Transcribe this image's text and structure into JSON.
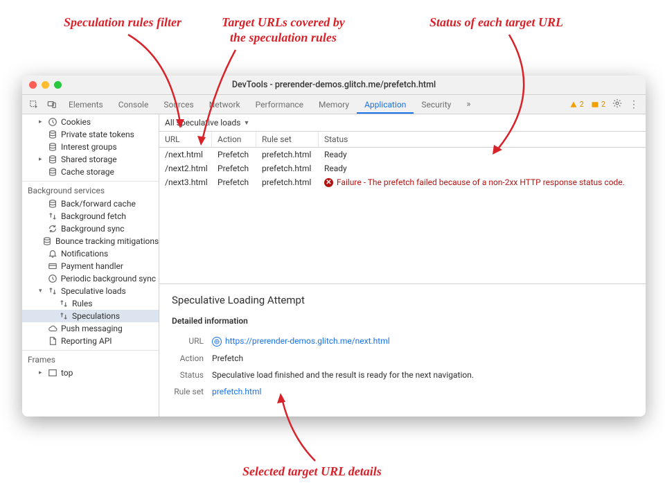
{
  "annotations": {
    "filter": "Speculation rules filter",
    "targets": "Target URLs covered by\nthe speculation rules",
    "status": "Status of each target URL",
    "details": "Selected target URL details"
  },
  "window": {
    "title": "DevTools - prerender-demos.glitch.me/prefetch.html"
  },
  "tabs": {
    "items": [
      "Elements",
      "Console",
      "Sources",
      "Network",
      "Performance",
      "Memory",
      "Application",
      "Security"
    ],
    "active": "Application",
    "overflow": "»",
    "warn_count": "2",
    "info_count": "2"
  },
  "sidebar": {
    "storage": [
      {
        "label": "Cookies",
        "icon": "clock",
        "expandable": true
      },
      {
        "label": "Private state tokens",
        "icon": "db"
      },
      {
        "label": "Interest groups",
        "icon": "db"
      },
      {
        "label": "Shared storage",
        "icon": "db",
        "expandable": true
      },
      {
        "label": "Cache storage",
        "icon": "db"
      }
    ],
    "bg_header": "Background services",
    "bg": [
      {
        "label": "Back/forward cache",
        "icon": "db"
      },
      {
        "label": "Background fetch",
        "icon": "updown"
      },
      {
        "label": "Background sync",
        "icon": "sync"
      },
      {
        "label": "Bounce tracking mitigations",
        "icon": "db"
      },
      {
        "label": "Notifications",
        "icon": "bell"
      },
      {
        "label": "Payment handler",
        "icon": "card"
      },
      {
        "label": "Periodic background sync",
        "icon": "clock"
      },
      {
        "label": "Speculative loads",
        "icon": "updown",
        "expanded": true
      },
      {
        "label": "Rules",
        "icon": "updown",
        "indent": true
      },
      {
        "label": "Speculations",
        "icon": "updown",
        "indent": true,
        "selected": true
      },
      {
        "label": "Push messaging",
        "icon": "cloud"
      },
      {
        "label": "Reporting API",
        "icon": "doc"
      }
    ],
    "frames_header": "Frames",
    "frames": [
      {
        "label": "top",
        "icon": "frame",
        "expandable": true
      }
    ]
  },
  "toolbar": {
    "filter_label": "All speculative loads"
  },
  "table": {
    "headers": {
      "url": "URL",
      "action": "Action",
      "ruleset": "Rule set",
      "status": "Status"
    },
    "rows": [
      {
        "url": "/next.html",
        "action": "Prefetch",
        "ruleset": "prefetch.html",
        "status": "Ready",
        "error": false
      },
      {
        "url": "/next2.html",
        "action": "Prefetch",
        "ruleset": "prefetch.html",
        "status": "Ready",
        "error": false
      },
      {
        "url": "/next3.html",
        "action": "Prefetch",
        "ruleset": "prefetch.html",
        "status": "Failure - The prefetch failed because of a non-2xx HTTP response status code.",
        "error": true
      }
    ]
  },
  "details": {
    "heading": "Speculative Loading Attempt",
    "subheading": "Detailed information",
    "rows": {
      "url_label": "URL",
      "url_value": "https://prerender-demos.glitch.me/next.html",
      "action_label": "Action",
      "action_value": "Prefetch",
      "status_label": "Status",
      "status_value": "Speculative load finished and the result is ready for the next navigation.",
      "ruleset_label": "Rule set",
      "ruleset_value": "prefetch.html"
    }
  }
}
